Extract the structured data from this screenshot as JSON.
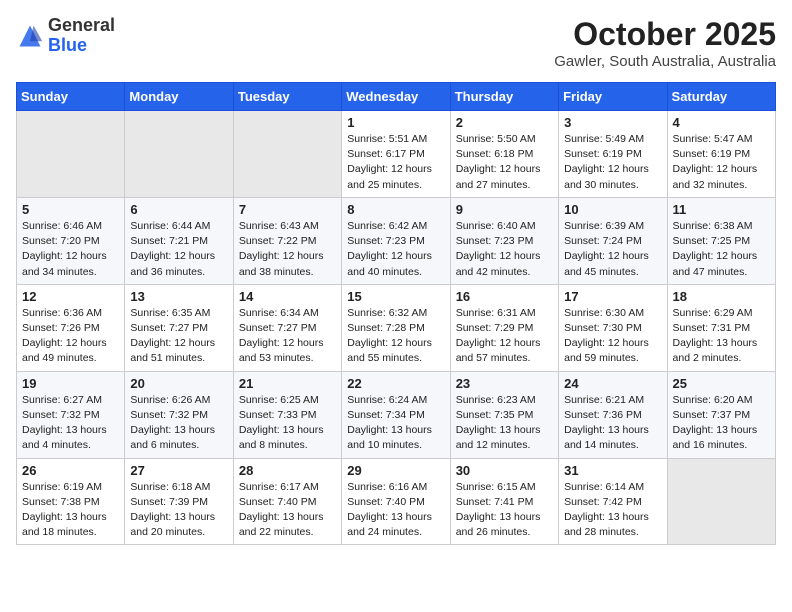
{
  "header": {
    "logo_line1": "General",
    "logo_line2": "Blue",
    "month": "October 2025",
    "location": "Gawler, South Australia, Australia"
  },
  "weekdays": [
    "Sunday",
    "Monday",
    "Tuesday",
    "Wednesday",
    "Thursday",
    "Friday",
    "Saturday"
  ],
  "weeks": [
    [
      {
        "day": "",
        "info": ""
      },
      {
        "day": "",
        "info": ""
      },
      {
        "day": "",
        "info": ""
      },
      {
        "day": "1",
        "info": "Sunrise: 5:51 AM\nSunset: 6:17 PM\nDaylight: 12 hours\nand 25 minutes."
      },
      {
        "day": "2",
        "info": "Sunrise: 5:50 AM\nSunset: 6:18 PM\nDaylight: 12 hours\nand 27 minutes."
      },
      {
        "day": "3",
        "info": "Sunrise: 5:49 AM\nSunset: 6:19 PM\nDaylight: 12 hours\nand 30 minutes."
      },
      {
        "day": "4",
        "info": "Sunrise: 5:47 AM\nSunset: 6:19 PM\nDaylight: 12 hours\nand 32 minutes."
      }
    ],
    [
      {
        "day": "5",
        "info": "Sunrise: 6:46 AM\nSunset: 7:20 PM\nDaylight: 12 hours\nand 34 minutes."
      },
      {
        "day": "6",
        "info": "Sunrise: 6:44 AM\nSunset: 7:21 PM\nDaylight: 12 hours\nand 36 minutes."
      },
      {
        "day": "7",
        "info": "Sunrise: 6:43 AM\nSunset: 7:22 PM\nDaylight: 12 hours\nand 38 minutes."
      },
      {
        "day": "8",
        "info": "Sunrise: 6:42 AM\nSunset: 7:23 PM\nDaylight: 12 hours\nand 40 minutes."
      },
      {
        "day": "9",
        "info": "Sunrise: 6:40 AM\nSunset: 7:23 PM\nDaylight: 12 hours\nand 42 minutes."
      },
      {
        "day": "10",
        "info": "Sunrise: 6:39 AM\nSunset: 7:24 PM\nDaylight: 12 hours\nand 45 minutes."
      },
      {
        "day": "11",
        "info": "Sunrise: 6:38 AM\nSunset: 7:25 PM\nDaylight: 12 hours\nand 47 minutes."
      }
    ],
    [
      {
        "day": "12",
        "info": "Sunrise: 6:36 AM\nSunset: 7:26 PM\nDaylight: 12 hours\nand 49 minutes."
      },
      {
        "day": "13",
        "info": "Sunrise: 6:35 AM\nSunset: 7:27 PM\nDaylight: 12 hours\nand 51 minutes."
      },
      {
        "day": "14",
        "info": "Sunrise: 6:34 AM\nSunset: 7:27 PM\nDaylight: 12 hours\nand 53 minutes."
      },
      {
        "day": "15",
        "info": "Sunrise: 6:32 AM\nSunset: 7:28 PM\nDaylight: 12 hours\nand 55 minutes."
      },
      {
        "day": "16",
        "info": "Sunrise: 6:31 AM\nSunset: 7:29 PM\nDaylight: 12 hours\nand 57 minutes."
      },
      {
        "day": "17",
        "info": "Sunrise: 6:30 AM\nSunset: 7:30 PM\nDaylight: 12 hours\nand 59 minutes."
      },
      {
        "day": "18",
        "info": "Sunrise: 6:29 AM\nSunset: 7:31 PM\nDaylight: 13 hours\nand 2 minutes."
      }
    ],
    [
      {
        "day": "19",
        "info": "Sunrise: 6:27 AM\nSunset: 7:32 PM\nDaylight: 13 hours\nand 4 minutes."
      },
      {
        "day": "20",
        "info": "Sunrise: 6:26 AM\nSunset: 7:32 PM\nDaylight: 13 hours\nand 6 minutes."
      },
      {
        "day": "21",
        "info": "Sunrise: 6:25 AM\nSunset: 7:33 PM\nDaylight: 13 hours\nand 8 minutes."
      },
      {
        "day": "22",
        "info": "Sunrise: 6:24 AM\nSunset: 7:34 PM\nDaylight: 13 hours\nand 10 minutes."
      },
      {
        "day": "23",
        "info": "Sunrise: 6:23 AM\nSunset: 7:35 PM\nDaylight: 13 hours\nand 12 minutes."
      },
      {
        "day": "24",
        "info": "Sunrise: 6:21 AM\nSunset: 7:36 PM\nDaylight: 13 hours\nand 14 minutes."
      },
      {
        "day": "25",
        "info": "Sunrise: 6:20 AM\nSunset: 7:37 PM\nDaylight: 13 hours\nand 16 minutes."
      }
    ],
    [
      {
        "day": "26",
        "info": "Sunrise: 6:19 AM\nSunset: 7:38 PM\nDaylight: 13 hours\nand 18 minutes."
      },
      {
        "day": "27",
        "info": "Sunrise: 6:18 AM\nSunset: 7:39 PM\nDaylight: 13 hours\nand 20 minutes."
      },
      {
        "day": "28",
        "info": "Sunrise: 6:17 AM\nSunset: 7:40 PM\nDaylight: 13 hours\nand 22 minutes."
      },
      {
        "day": "29",
        "info": "Sunrise: 6:16 AM\nSunset: 7:40 PM\nDaylight: 13 hours\nand 24 minutes."
      },
      {
        "day": "30",
        "info": "Sunrise: 6:15 AM\nSunset: 7:41 PM\nDaylight: 13 hours\nand 26 minutes."
      },
      {
        "day": "31",
        "info": "Sunrise: 6:14 AM\nSunset: 7:42 PM\nDaylight: 13 hours\nand 28 minutes."
      },
      {
        "day": "",
        "info": ""
      }
    ]
  ]
}
